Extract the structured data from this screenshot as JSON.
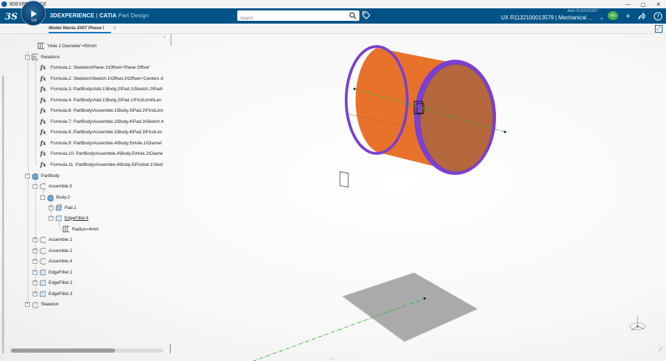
{
  "os": {
    "title": "3DEXPERIENCE",
    "controls": [
      "—",
      "▢",
      "✕"
    ]
  },
  "header": {
    "brand_bold": "3DEXPERIENCE",
    "brand_sep": " | ",
    "brand_product": "CATIA",
    "brand_app": "Part Design",
    "compass_version": "V.R",
    "search_placeholder": "Search",
    "user_name": "Alain DUGOUSSET",
    "product_id": "UX R1132100013579 | Mechanical ...",
    "avatar_initials": "AD"
  },
  "tabs": {
    "active_label": "Model Mania 2007 Phase I",
    "add_label": "+"
  },
  "tree": {
    "items": [
      {
        "label": "'Hole 2 Diameter'=50mm"
      },
      {
        "label": "Relations"
      },
      {
        "label": "Formula.1: Skeleton\\Plane.1\\Offset='Plane Offset'"
      },
      {
        "label": "Formula.2: Skeleton\\Sketch.1\\Offset.2\\Offset='Centers d"
      },
      {
        "label": "Formula.3: PartBody\\Add.1\\Body.2\\Pad.1\\Sketch.2\\Radi"
      },
      {
        "label": "Formula.4: PartBody\\Add.1\\Body.2\\Pad.1\\FirstLimit\\Len"
      },
      {
        "label": "Formula.6: PartBody\\Assemble.1\\Body.3\\Pad.2\\FirstLimi"
      },
      {
        "label": "Formula.7: PartBody\\Assemble.2\\Body.4\\Pad.3\\Sketch.4"
      },
      {
        "label": "Formula.8: PartBody\\Assemble.2\\Body.4\\Pad.3\\FirstLim"
      },
      {
        "label": "Formula.9: PartBody\\Assemble.4\\Body.5\\Hole.1\\Diamet"
      },
      {
        "label": "Formula.10: PartBody\\Assemble.4\\Body.5\\Hole.2\\Diame"
      },
      {
        "label": "Formula.11: PartBody\\Assemble.4\\Body.5\\Pocket.1\\Sket"
      },
      {
        "label": "PartBody"
      },
      {
        "label": "Assemble.5"
      },
      {
        "label": "Body.2"
      },
      {
        "label": "Pad.1"
      },
      {
        "label": "EdgeFillet.4"
      },
      {
        "label": "Radius=4mm"
      },
      {
        "label": "Assemble.1"
      },
      {
        "label": "Assemble.2"
      },
      {
        "label": "Assemble.4"
      },
      {
        "label": "EdgeFillet.1"
      },
      {
        "label": "EdgeFillet.2"
      },
      {
        "label": "EdgeFillet.3"
      },
      {
        "label": "Skeleton"
      }
    ]
  },
  "colors": {
    "header_bg": "#005386",
    "cylinder_body": "#e8722a",
    "cylinder_face": "#b8683d",
    "fillet": "#7b3fd4",
    "axis_line": "#2fb32f",
    "plane": "#a9a9a9"
  }
}
